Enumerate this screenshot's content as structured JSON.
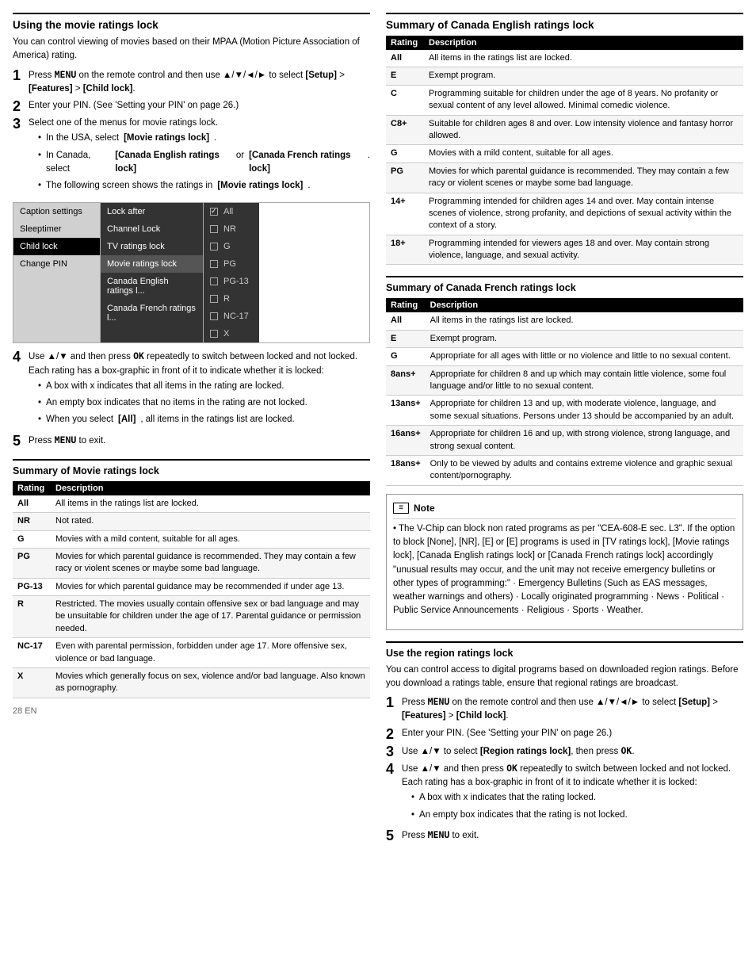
{
  "page": {
    "footer": "28  EN"
  },
  "left": {
    "section1": {
      "title": "Using the movie ratings lock",
      "intro": "You can control viewing of movies based on their MPAA (Motion Picture Association of America) rating.",
      "steps": [
        {
          "num": "1",
          "text": "Press MENU on the remote control and then use ▲/▼/◄/► to select [Setup] > [Features] > [Child lock]."
        },
        {
          "num": "2",
          "text": "Enter your PIN. (See 'Setting your PIN' on page 26.)"
        },
        {
          "num": "3",
          "text": "Select one of the menus for movie ratings lock.",
          "bullets": [
            "In the USA, select [Movie ratings lock].",
            "In Canada, select [Canada English ratings lock] or [Canada French ratings lock].",
            "The following screen shows the ratings in [Movie ratings lock]."
          ]
        }
      ],
      "step4": {
        "num": "4",
        "text": "Use ▲/▼ and then press OK repeatedly to switch between locked and not locked. Each rating has a box-graphic in front of it to indicate whether it is locked:",
        "bullets": [
          "A box with x indicates that all items in the rating are locked.",
          "An empty box indicates that no items in the rating are not locked.",
          "When you select [All], all items in the ratings list are locked."
        ]
      },
      "step5": {
        "num": "5",
        "text": "Press MENU to exit."
      }
    },
    "menu": {
      "left_items": [
        {
          "label": "Caption settings",
          "selected": false
        },
        {
          "label": "Sleeptimer",
          "selected": false
        },
        {
          "label": "Child lock",
          "selected": true
        },
        {
          "label": "Change PIN",
          "selected": false
        },
        {
          "label": "",
          "selected": false
        },
        {
          "label": "",
          "selected": false
        }
      ],
      "mid_items": [
        {
          "label": "Lock after",
          "selected": false
        },
        {
          "label": "Channel Lock",
          "selected": false
        },
        {
          "label": "TV ratings lock",
          "selected": false
        },
        {
          "label": "Movie ratings lock",
          "selected": true
        },
        {
          "label": "Canada English ratings l...",
          "selected": false
        },
        {
          "label": "Canada French ratings l...",
          "selected": false
        }
      ],
      "right_items": [
        {
          "label": "All",
          "checked": true
        },
        {
          "label": "NR",
          "checked": false
        },
        {
          "label": "G",
          "checked": false
        },
        {
          "label": "PG",
          "checked": false
        },
        {
          "label": "PG-13",
          "checked": false
        },
        {
          "label": "R",
          "checked": false
        },
        {
          "label": "NC-17",
          "checked": false
        },
        {
          "label": "X",
          "checked": false
        }
      ]
    },
    "section2": {
      "title": "Summary of Movie ratings lock",
      "table": {
        "headers": [
          "Rating",
          "Description"
        ],
        "rows": [
          [
            "All",
            "All items in the ratings list are locked."
          ],
          [
            "NR",
            "Not rated."
          ],
          [
            "G",
            "Movies with a mild content, suitable for all ages."
          ],
          [
            "PG",
            "Movies for which parental guidance is recommended. They may contain a few racy or violent scenes or maybe some bad language."
          ],
          [
            "PG-13",
            "Movies for which parental guidance may be recommended if under age 13."
          ],
          [
            "R",
            "Restricted. The movies usually contain offensive sex or bad language and may be unsuitable for children under the age of 17. Parental guidance or permission needed."
          ],
          [
            "NC-17",
            "Even with parental permission, forbidden under age 17. More offensive sex, violence or bad language."
          ],
          [
            "X",
            "Movies which generally focus on sex, violence and/or bad language. Also known as pornography."
          ]
        ]
      }
    }
  },
  "right": {
    "section1": {
      "title": "Summary of Canada English ratings lock",
      "table": {
        "headers": [
          "Rating",
          "Description"
        ],
        "rows": [
          [
            "All",
            "All items in the ratings list are locked."
          ],
          [
            "E",
            "Exempt program."
          ],
          [
            "C",
            "Programming suitable for children under the age of 8 years. No profanity or sexual content of any level allowed. Minimal comedic violence."
          ],
          [
            "C8+",
            "Suitable for children ages 8 and over. Low intensity violence and fantasy horror allowed."
          ],
          [
            "G",
            "Movies with a mild content, suitable for all ages."
          ],
          [
            "PG",
            "Movies for which parental guidance is recommended. They may contain a few racy or violent scenes or maybe some bad language."
          ],
          [
            "14+",
            "Programming intended for children ages 14 and over. May contain intense scenes of violence, strong profanity, and depictions of sexual activity within the context of a story."
          ],
          [
            "18+",
            "Programming intended for viewers ages 18 and over. May contain strong violence, language, and sexual activity."
          ]
        ]
      }
    },
    "section2": {
      "title": "Summary of Canada French ratings lock",
      "table": {
        "headers": [
          "Rating",
          "Description"
        ],
        "rows": [
          [
            "All",
            "All items in the ratings list are locked."
          ],
          [
            "E",
            "Exempt program."
          ],
          [
            "G",
            "Appropriate for all ages with little or no violence and little to no sexual content."
          ],
          [
            "8ans+",
            "Appropriate for children 8 and up which may contain little violence, some foul language and/or little to no sexual content."
          ],
          [
            "13ans+",
            "Appropriate for children 13 and up, with moderate violence, language, and some sexual situations. Persons under 13 should be accompanied by an adult."
          ],
          [
            "16ans+",
            "Appropriate for children 16 and up, with strong violence, strong language, and strong sexual content."
          ],
          [
            "18ans+",
            "Only to be viewed by adults and contains extreme violence and graphic sexual content/pornography."
          ]
        ]
      }
    },
    "note": {
      "header": "Note",
      "content": "The V-Chip can block non rated programs as per \"CEA-608-E sec. L3\". If the option to block [None], [NR], [E] or [E] programs is used in [TV ratings lock], [Movie ratings lock], [Canada English ratings lock] or [Canada French ratings lock] accordingly \"unusual results may occur, and the unit may not receive emergency bulletins or other types of programming:\" · Emergency Bulletins (Such as EAS messages, weather warnings and others) · Locally originated programming · News · Political · Public Service Announcements · Religious · Sports · Weather."
    },
    "section3": {
      "title": "Use the region ratings lock",
      "intro": "You can control access to digital programs based on downloaded region ratings. Before you download a ratings table, ensure that regional ratings are broadcast.",
      "steps": [
        {
          "num": "1",
          "text": "Press MENU on the remote control and then use ▲/▼/◄/► to select [Setup] > [Features] > [Child lock]."
        },
        {
          "num": "2",
          "text": "Enter your PIN. (See 'Setting your PIN' on page 26.)"
        },
        {
          "num": "3",
          "text": "Use ▲/▼ to select [Region ratings lock], then press OK."
        },
        {
          "num": "4",
          "text": "Use ▲/▼ and then press OK repeatedly to switch between locked and not locked. Each rating has a box-graphic in front of it to indicate whether it is locked:",
          "bullets": [
            "A box with x indicates that the rating locked.",
            "An empty box indicates that the rating is not locked."
          ]
        },
        {
          "num": "5",
          "text": "Press MENU to exit."
        }
      ]
    }
  }
}
